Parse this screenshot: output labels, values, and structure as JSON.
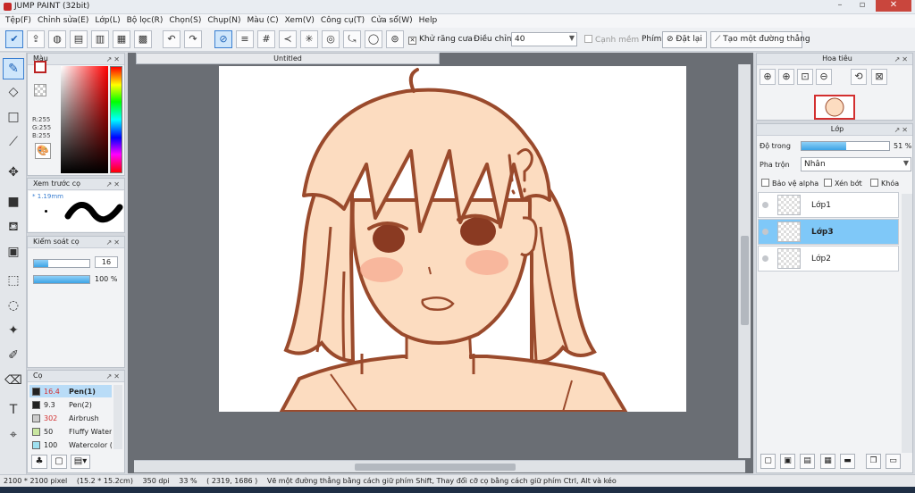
{
  "window": {
    "title": "JUMP PAINT (32bit)",
    "min": "–",
    "max": "▫",
    "close": "✕"
  },
  "menu": [
    "Tệp(F)",
    "Chỉnh sửa(E)",
    "Lớp(L)",
    "Bộ lọc(R)",
    "Chọn(S)",
    "Chụp(N)",
    "Màu (C)",
    "Xem(V)",
    "Công cụ(T)",
    "Cửa sổ(W)",
    "Help"
  ],
  "toolbar": {
    "antialias_label": "Khử răng cưa",
    "adjust_label": "Điều chỉnh",
    "adjust_value": "40",
    "smooth_label": "Cạnh mềm",
    "key_label": "Phím",
    "reset_label": "Đặt lại",
    "line_label": "Tạo một đường thẳng"
  },
  "panels": {
    "color": {
      "title": "Màu",
      "r": "R:255",
      "g": "G:255",
      "b": "B:255"
    },
    "brush_preview": {
      "title": "Xem trước cọ",
      "size": "1.19mm"
    },
    "brush_control": {
      "title": "Kiểm soát cọ",
      "size_value": "16",
      "opacity_value": "100 %",
      "size_fraction": 0.25,
      "opacity_fraction": 1.0
    },
    "brush": {
      "title": "Cọ",
      "items": [
        {
          "size": "16.4",
          "name": "Pen(1)",
          "color": "#222222"
        },
        {
          "size": "9.3",
          "name": "Pen(2)",
          "color": "#222222"
        },
        {
          "size": "302",
          "name": "Airbrush",
          "color": "#cccccc"
        },
        {
          "size": "50",
          "name": "Fluffy Water",
          "color": "#c8e6a0"
        },
        {
          "size": "100",
          "name": "Watercolor (",
          "color": "#9ee0f0"
        }
      ]
    },
    "navigator": {
      "title": "Hoa tiêu"
    },
    "layer": {
      "title": "Lớp",
      "opacity_label": "Độ trong",
      "opacity_value": "51 %",
      "opacity_fraction": 0.51,
      "blend_label": "Pha trộn",
      "blend_value": "Nhân",
      "protect_alpha": "Bảo vệ alpha",
      "clip": "Xén bớt",
      "lock": "Khóa",
      "layers": [
        {
          "name": "Lớp1",
          "selected": false
        },
        {
          "name": "Lớp3",
          "selected": true
        },
        {
          "name": "Lớp2",
          "selected": false
        }
      ]
    }
  },
  "document": {
    "tab": "Untitled"
  },
  "status": {
    "size": "2100 * 2100 pixel",
    "cm": "(15.2 * 15.2cm)",
    "dpi": "350 dpi",
    "zoom": "33 %",
    "coords": "( 2319, 1686 )",
    "hint": "Vẽ một đường thẳng bằng cách giữ phím Shift, Thay đổi cỡ cọ bằng cách giữ phím Ctrl, Alt và kéo"
  },
  "colors": {
    "accent": "#3a7fd1",
    "skin": "#fcdcc0",
    "line": "#9a4a2c",
    "selected_layer": "#7fc8f8"
  }
}
